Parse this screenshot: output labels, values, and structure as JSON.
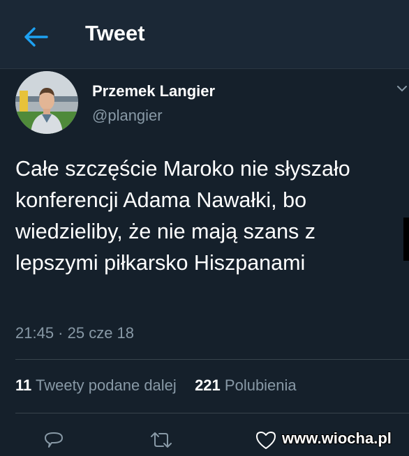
{
  "header": {
    "title": "Tweet",
    "back_icon": "arrow-left-icon"
  },
  "tweet": {
    "author": {
      "name": "Przemek Langier",
      "handle": "@plangier"
    },
    "text": "Całe szczęście Maroko nie słyszało konferencji Adama Nawałki, bo wiedzieliby, że nie mają szans z lepszymi piłkarsko Hiszpanami",
    "timestamp": "21:45 · 25 cze 18",
    "stats": {
      "retweets_count": "11",
      "retweets_label": "Tweety podane dalej",
      "likes_count": "221",
      "likes_label": "Polubienia"
    }
  },
  "actions": [
    "reply-icon",
    "retweet-icon",
    "heart-icon"
  ],
  "watermark": "www.wiocha.pl",
  "colors": {
    "background": "#15202b",
    "header": "#1b2836",
    "accent": "#1da1f2",
    "secondary_text": "#8899a6"
  }
}
